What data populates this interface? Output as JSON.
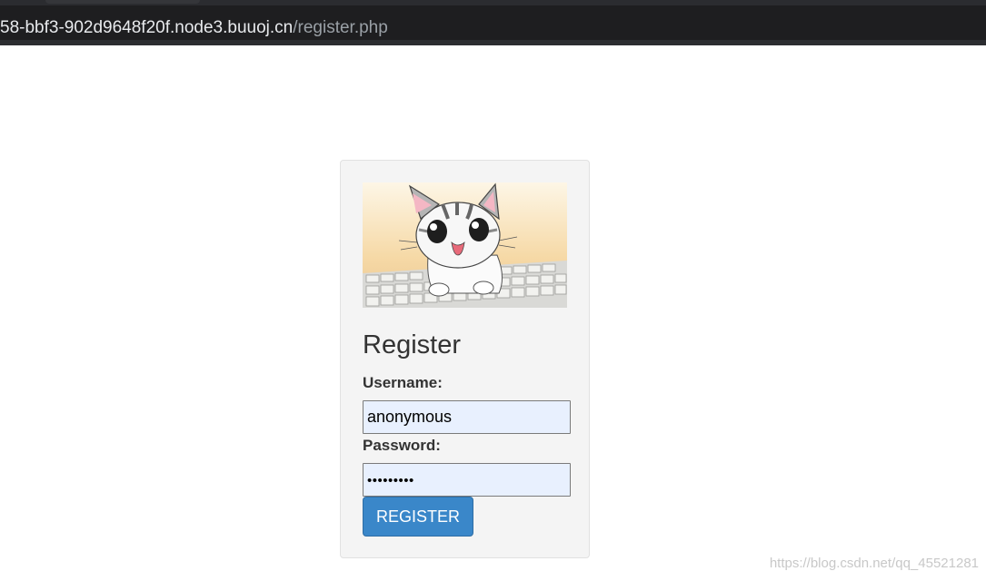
{
  "browser": {
    "url_host": "58-bbf3-902d9648f20f.node3.buuoj.cn",
    "url_path": "/register.php"
  },
  "form": {
    "image_name": "cat-typing-on-keyboard",
    "title": "Register",
    "username_label": "Username:",
    "username_value": "anonymous",
    "password_label": "Password:",
    "password_mask": "•••••••••",
    "submit_label": "REGISTER"
  },
  "watermark": "https://blog.csdn.net/qq_45521281",
  "colors": {
    "button": "#3a87c9",
    "input_autofill": "#e8f0fe",
    "card_bg": "#f4f4f4"
  }
}
